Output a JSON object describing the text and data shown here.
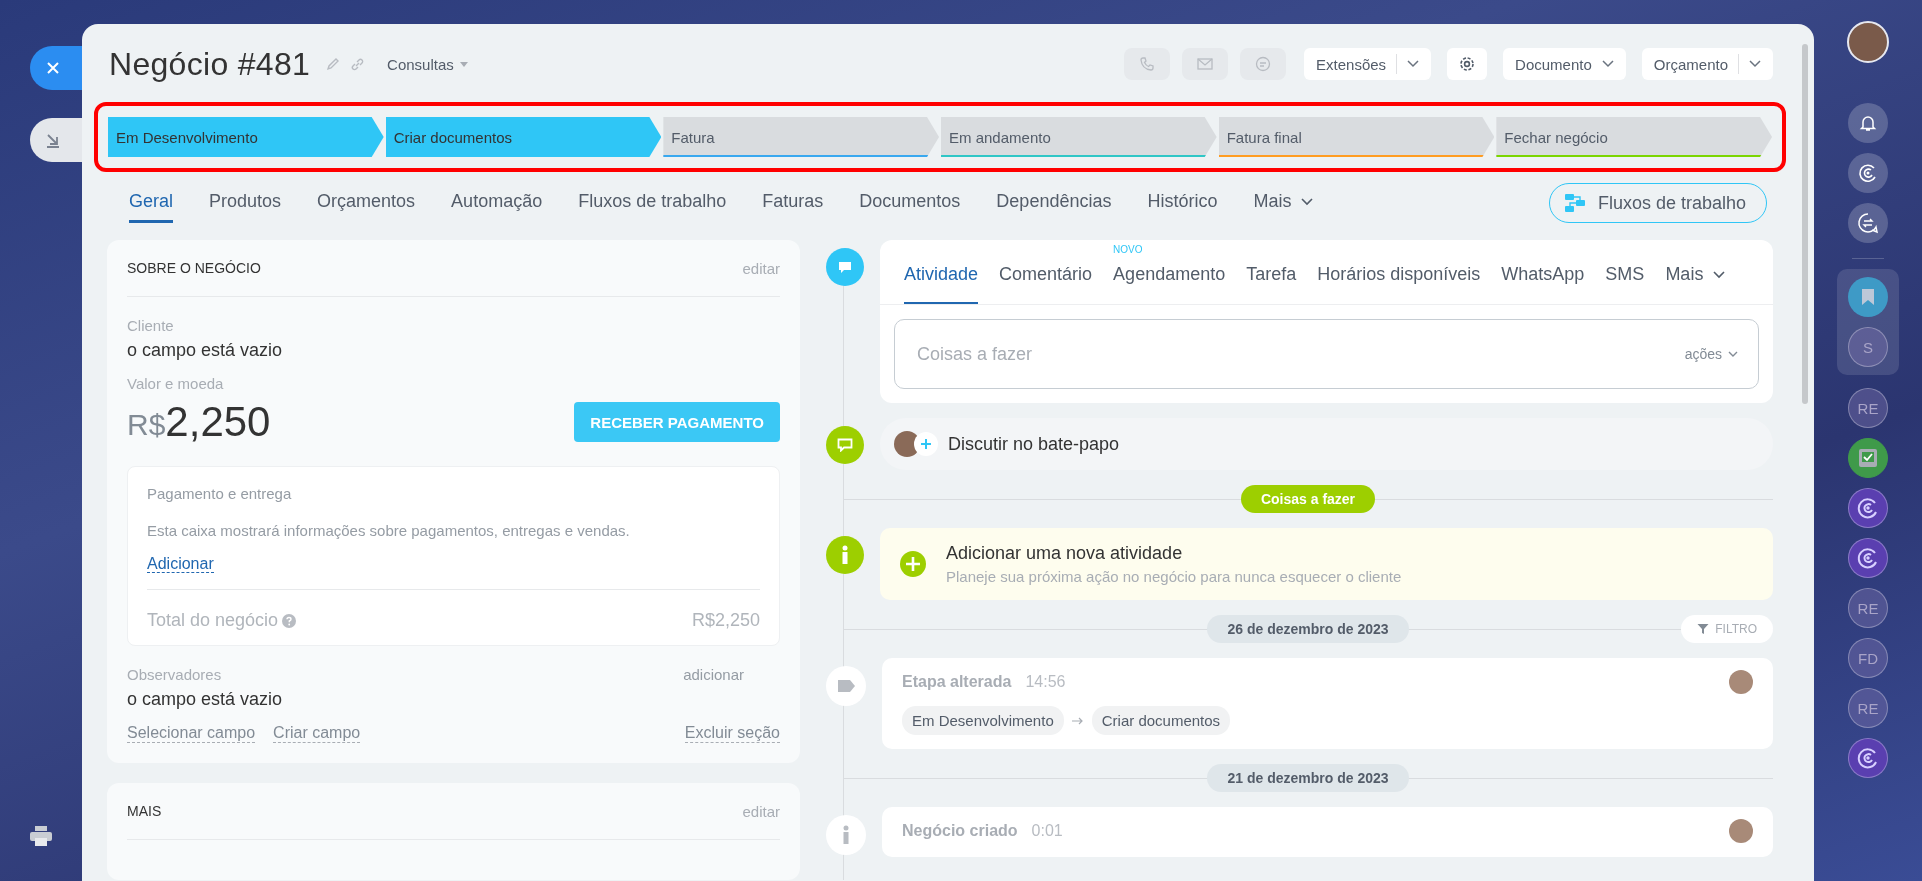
{
  "header": {
    "title": "Negócio #481",
    "category": "Consultas",
    "buttons": [
      "Extensões",
      "Documento",
      "Orçamento"
    ]
  },
  "stages": [
    {
      "label": "Em Desenvolvimento",
      "selected": true,
      "color": "#2fc6f6"
    },
    {
      "label": "Criar documentos",
      "selected": true,
      "color": "#2fc6f6"
    },
    {
      "label": "Fatura",
      "selected": false,
      "color": "#39a8ef"
    },
    {
      "label": "Em andamento",
      "selected": false,
      "color": "#2fc6c6"
    },
    {
      "label": "Fatura final",
      "selected": false,
      "color": "#ff9c21"
    },
    {
      "label": "Fechar negócio",
      "selected": false,
      "color": "#7bd500"
    }
  ],
  "tabs": [
    {
      "label": "Geral",
      "selected": true
    },
    {
      "label": "Produtos",
      "selected": false
    },
    {
      "label": "Orçamentos",
      "selected": false
    },
    {
      "label": "Automação",
      "selected": false
    },
    {
      "label": "Fluxos de trabalho",
      "selected": false
    },
    {
      "label": "Faturas",
      "selected": false
    },
    {
      "label": "Documentos",
      "selected": false
    },
    {
      "label": "Dependências",
      "selected": false
    },
    {
      "label": "Histórico",
      "selected": false
    },
    {
      "label": "Mais",
      "selected": false
    }
  ],
  "workflow_button": "Fluxos de trabalho",
  "about": {
    "title": "SOBRE O NEGÓCIO",
    "edit": "editar",
    "client_label": "Cliente",
    "client_value": "o campo está vazio",
    "amount_label": "Valor e moeda",
    "currency": "R$",
    "amount": "2,250",
    "pay_button": "RECEBER PAGAMENTO",
    "payment": {
      "title": "Pagamento e entrega",
      "description": "Esta caixa mostrará informações sobre pagamentos, entregas e vendas.",
      "add_link": "Adicionar",
      "total_label": "Total do negócio",
      "total_value": "R$2,250"
    },
    "observers_label": "Observadores",
    "observers_add": "adicionar",
    "observers_value": "o campo está vazio",
    "links": [
      "Selecionar campo",
      "Criar campo"
    ],
    "delete_link": "Excluir seção"
  },
  "more": {
    "title": "MAIS",
    "edit": "editar"
  },
  "activity": {
    "tabs": [
      {
        "label": "Atividade",
        "selected": true
      },
      {
        "label": "Comentário",
        "selected": false
      },
      {
        "label": "Agendamento",
        "selected": false,
        "badge": "NOVO"
      },
      {
        "label": "Tarefa",
        "selected": false
      },
      {
        "label": "Horários disponíveis",
        "selected": false
      },
      {
        "label": "WhatsApp",
        "selected": false
      },
      {
        "label": "SMS",
        "selected": false
      },
      {
        "label": "Mais",
        "selected": false
      }
    ],
    "placeholder": "Coisas a fazer",
    "actions": "ações"
  },
  "chat": "Discutir no bate-papo",
  "todo_label": "Coisas a fazer",
  "add_activity": {
    "title": "Adicionar uma nova atividade",
    "subtitle": "Planeje sua próxima ação no negócio para nunca esquecer o cliente"
  },
  "history": [
    {
      "date": "26 de dezembro de 2023",
      "filter": "FILTRO",
      "events": [
        {
          "kind": "stage",
          "title": "Etapa alterada",
          "time": "14:56",
          "from": "Em Desenvolvimento",
          "to": "Criar documentos"
        }
      ]
    },
    {
      "date": "21 de dezembro de 2023",
      "events": [
        {
          "kind": "created",
          "title": "Negócio criado",
          "time": "0:01"
        }
      ]
    }
  ],
  "rail": [
    {
      "kind": "avatar"
    },
    {
      "kind": "bell"
    },
    {
      "kind": "copilot"
    },
    {
      "kind": "chat"
    },
    {
      "kind": "bookmark"
    },
    {
      "kind": "initials",
      "label": "S"
    },
    {
      "kind": "initials",
      "label": "RE"
    },
    {
      "kind": "task"
    },
    {
      "kind": "copilot-app"
    },
    {
      "kind": "copilot-app"
    },
    {
      "kind": "initials",
      "label": "RE"
    },
    {
      "kind": "initials",
      "label": "FD"
    },
    {
      "kind": "initials",
      "label": "RE"
    },
    {
      "kind": "copilot-app"
    }
  ]
}
